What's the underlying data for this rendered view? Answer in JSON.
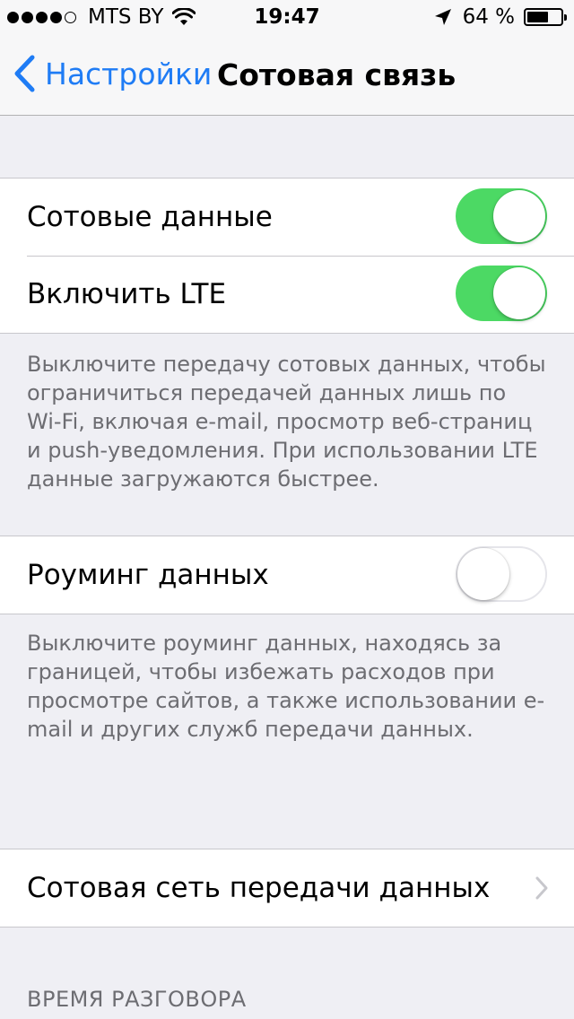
{
  "status_bar": {
    "signal_filled": 4,
    "signal_total": 5,
    "carrier": "MTS BY",
    "time": "19:47",
    "battery_percent": "64 %",
    "battery_level": 0.64
  },
  "nav": {
    "back_label": "Настройки",
    "title": "Сотовая связь",
    "accent_color": "#1f7cf5"
  },
  "group1": {
    "cellular_data": {
      "label": "Сотовые данные",
      "on": true
    },
    "enable_lte": {
      "label": "Включить LTE",
      "on": true
    }
  },
  "footer1": "Выключите передачу сотовых данных, чтобы ограничиться передачей данных лишь по Wi-Fi, включая e-mail, просмотр веб-страниц и push-уведомления. При использовании LTE данные загружаются быстрее.",
  "group2": {
    "data_roaming": {
      "label": "Роуминг данных",
      "on": false
    }
  },
  "footer2": "Выключите роуминг данных, находясь за границей, чтобы избежать расходов при просмотре сайтов, а также использовании e-mail и других служб передачи данных.",
  "group3": {
    "cellular_data_network": {
      "label": "Сотовая сеть передачи данных"
    }
  },
  "section_header_call_time": "ВРЕМЯ РАЗГОВОРА",
  "colors": {
    "toggle_on": "#4cd964",
    "background": "#efeff4",
    "footer_text": "#6d6d72"
  }
}
